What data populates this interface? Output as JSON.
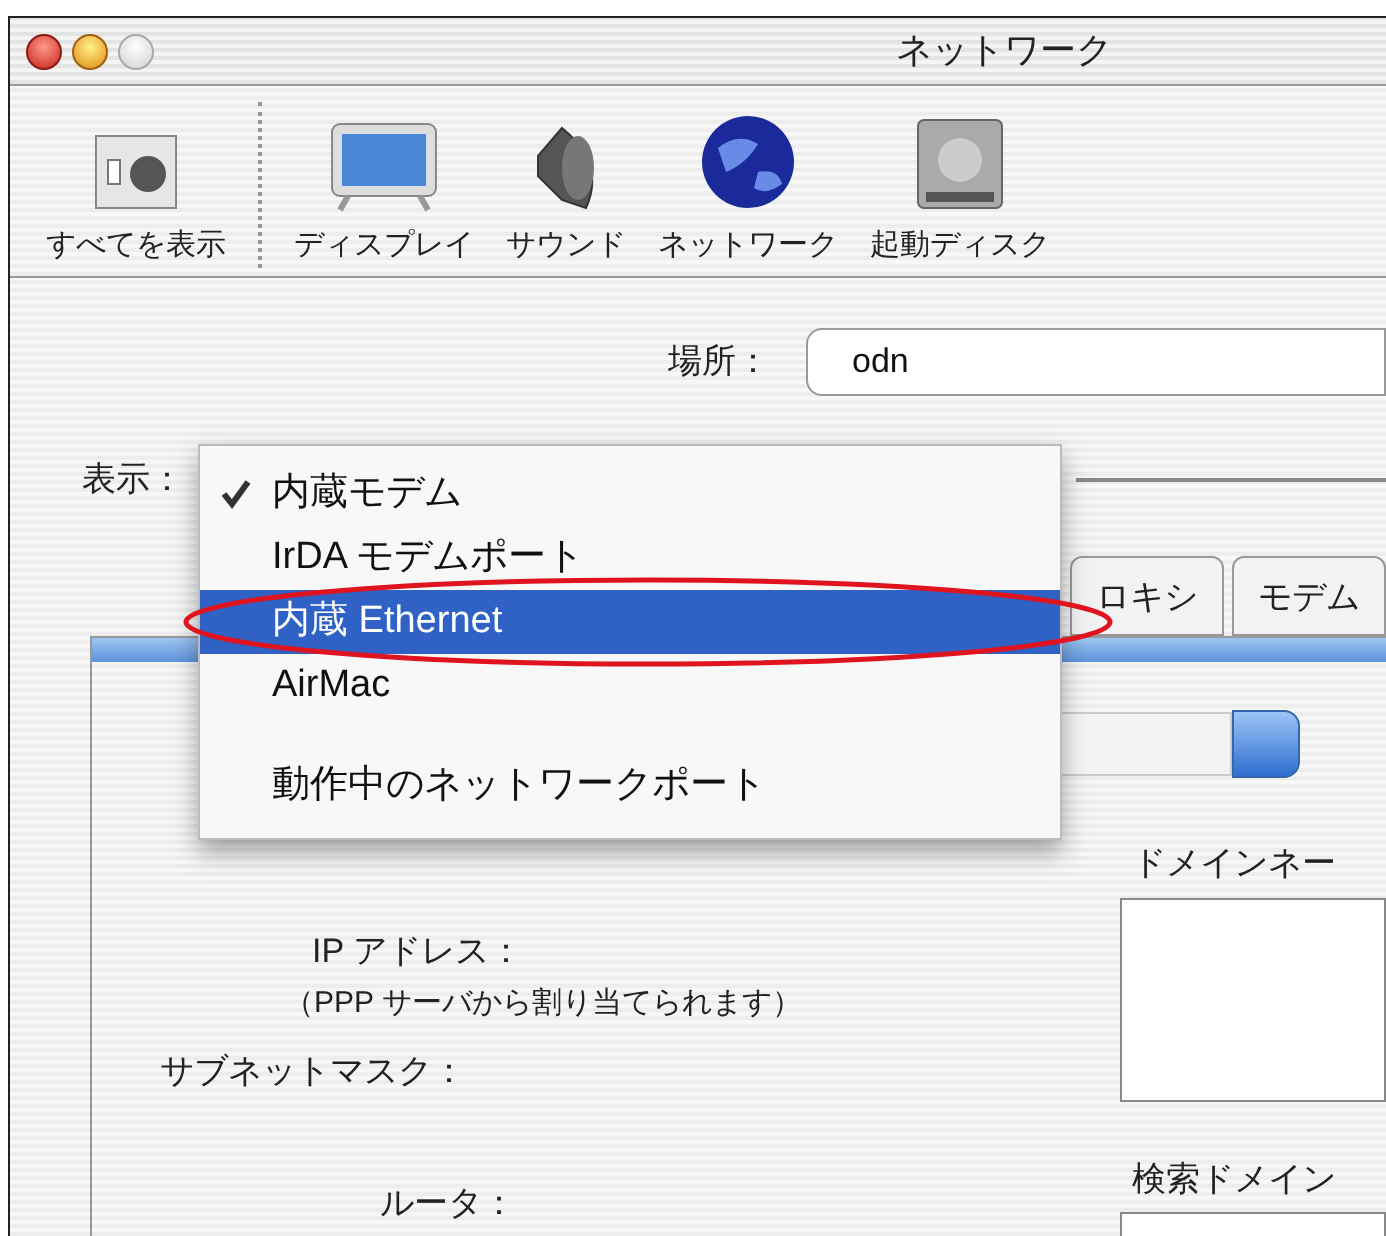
{
  "window": {
    "title": "ネットワーク"
  },
  "toolbar": [
    {
      "kind": "all",
      "label": "すべてを表示"
    },
    {
      "kind": "display",
      "label": "ディスプレイ"
    },
    {
      "kind": "sound",
      "label": "サウンド"
    },
    {
      "kind": "network",
      "label": "ネットワーク"
    },
    {
      "kind": "disk",
      "label": "起動ディスク"
    }
  ],
  "location": {
    "label": "場所：",
    "value": "odn"
  },
  "show": {
    "label": "表示："
  },
  "menu": [
    {
      "label": "内蔵モデム",
      "checked": true,
      "selected": false,
      "circled": false
    },
    {
      "label": "IrDA モデムポート",
      "checked": false,
      "selected": false,
      "circled": false
    },
    {
      "label": "内蔵 Ethernet",
      "checked": false,
      "selected": true,
      "circled": true
    },
    {
      "label": "AirMac",
      "checked": false,
      "selected": false,
      "circled": false
    },
    {
      "label": "動作中のネットワークポート",
      "checked": false,
      "selected": false,
      "circled": false
    }
  ],
  "tabs": [
    {
      "label": "ロキシ",
      "selected": false
    },
    {
      "label": "モデム",
      "selected": false
    }
  ],
  "fields": {
    "ip_label": "IP アドレス：",
    "ip_note": "（PPP サーバから割り当てられます）",
    "subnet_label": "サブネットマスク：",
    "router_label": "ルータ：",
    "domain_label": "ドメインネー",
    "search_label": "検索ドメイン"
  }
}
